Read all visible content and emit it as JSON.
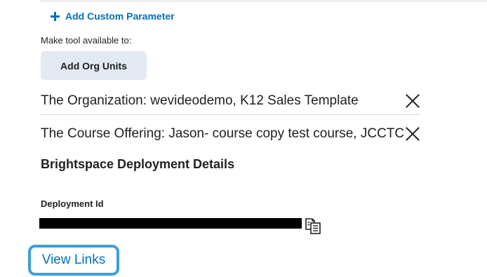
{
  "custom_params": {
    "add_label": "Add Custom Parameter",
    "icon": "plus-icon"
  },
  "availability": {
    "label": "Make tool available to:",
    "add_org_units_label": "Add Org Units",
    "org_units": [
      {
        "label": "The Organization: wevideodemo, K12 Sales Template",
        "remove_icon": "close-icon"
      },
      {
        "label": "The Course Offering: Jason- course copy test course, JCCTC",
        "remove_icon": "close-icon"
      }
    ]
  },
  "deployment": {
    "heading": "Brightspace Deployment Details",
    "id_label": "Deployment Id",
    "copy_icon": "copy-icon",
    "view_links_label": "View Links"
  },
  "colors": {
    "link": "#006fbf",
    "button_bg": "#e3e9f1",
    "focus_ring": "#3ea0d6",
    "text": "#202122"
  }
}
